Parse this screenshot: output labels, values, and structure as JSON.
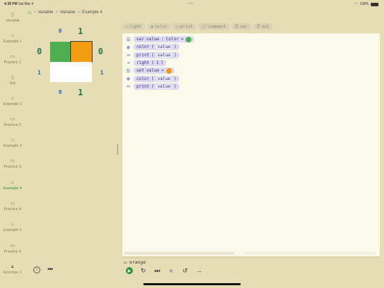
{
  "status": {
    "time": "4:39 PM",
    "date": "Sat Mar 4",
    "dots": "•••",
    "wifi_icon": "wifi-icon",
    "battery": "100%"
  },
  "sidebar": {
    "items": [
      {
        "label": "Variable",
        "icon": "document-icon",
        "active": false
      },
      {
        "label": "Example 1",
        "icon": "graduation-cap-icon",
        "active": false
      },
      {
        "label": "Practice 1",
        "icon": "keyboard-icon",
        "active": false
      },
      {
        "label": "Set",
        "icon": "document-icon",
        "active": false
      },
      {
        "label": "Example 2",
        "icon": "graduation-cap-icon",
        "active": false
      },
      {
        "label": "Practice 2",
        "icon": "keyboard-icon",
        "active": false
      },
      {
        "label": "Example 3",
        "icon": "graduation-cap-icon",
        "active": false
      },
      {
        "label": "Practice 3",
        "icon": "keyboard-icon",
        "active": false
      },
      {
        "label": "Example 4",
        "icon": "graduation-cap-icon",
        "active": true
      },
      {
        "label": "Practice 4",
        "icon": "keyboard-icon",
        "active": false
      },
      {
        "label": "Example 5",
        "icon": "graduation-cap-icon",
        "active": false
      },
      {
        "label": "Practice 5",
        "icon": "keyboard-icon",
        "active": false
      },
      {
        "label": "Exercise 1",
        "icon": "lock-icon",
        "active": false
      }
    ],
    "info_label": "i",
    "more_label": "•••"
  },
  "breadcrumb": {
    "items": [
      "Variable",
      "Variable",
      "Example 4"
    ],
    "sep": ">"
  },
  "grid": {
    "col_top": [
      "0",
      "1"
    ],
    "col_bottom": [
      "0",
      "1"
    ],
    "row_left": [
      "0",
      "1"
    ],
    "row_right": [
      "0",
      "1"
    ],
    "cells": [
      {
        "row": 0,
        "col": 0,
        "color": "#4caf50"
      },
      {
        "row": 0,
        "col": 1,
        "color": "#f39c12"
      },
      {
        "row": 1,
        "col": 0,
        "color": "#ffffff"
      },
      {
        "row": 1,
        "col": 1,
        "color": "#ffffff"
      }
    ],
    "selected_cell": {
      "row": 0,
      "col": 1
    }
  },
  "palette": [
    {
      "label": "right",
      "icon": "arrow-right-icon",
      "glyph": "→"
    },
    {
      "label": "color",
      "icon": "palette-icon",
      "glyph": "◍"
    },
    {
      "label": "print",
      "icon": "monitor-icon",
      "glyph": "▭"
    },
    {
      "label": "comment",
      "icon": "comment-icon",
      "glyph": "//"
    },
    {
      "label": "var",
      "icon": "list-icon",
      "glyph": "☰"
    },
    {
      "label": "set",
      "icon": "list-icon",
      "glyph": "☰"
    }
  ],
  "code": {
    "lines": [
      {
        "icon": "list-icon",
        "glyph": "☰",
        "parts": [
          "var",
          "value",
          ":",
          "Color",
          "="
        ],
        "dot": "#4caf50"
      },
      {
        "icon": "palette-icon",
        "glyph": "◍",
        "parts": [
          "color",
          "(",
          "value",
          ")"
        ]
      },
      {
        "icon": "monitor-icon",
        "glyph": "▭",
        "parts": [
          "print",
          "(",
          "value",
          ")"
        ]
      },
      {
        "icon": "arrow-right-icon",
        "glyph": "→",
        "parts": [
          "right",
          "(",
          "1",
          ")"
        ]
      },
      {
        "icon": "list-icon",
        "glyph": "☰",
        "parts": [
          "set",
          "value",
          "="
        ],
        "dot": "#f39c12"
      },
      {
        "icon": "palette-icon",
        "glyph": "◍",
        "parts": [
          "color",
          "(",
          "value",
          ")"
        ]
      },
      {
        "icon": "monitor-icon",
        "glyph": "▭",
        "parts": [
          "print",
          "(",
          "value",
          ")"
        ]
      }
    ]
  },
  "console": {
    "icon": "monitor-icon",
    "output": "orange"
  },
  "toolbar": {
    "run": "▶",
    "step_over": "↻",
    "step": "⏭",
    "stop": "■",
    "reset": "↺",
    "next": "→"
  }
}
